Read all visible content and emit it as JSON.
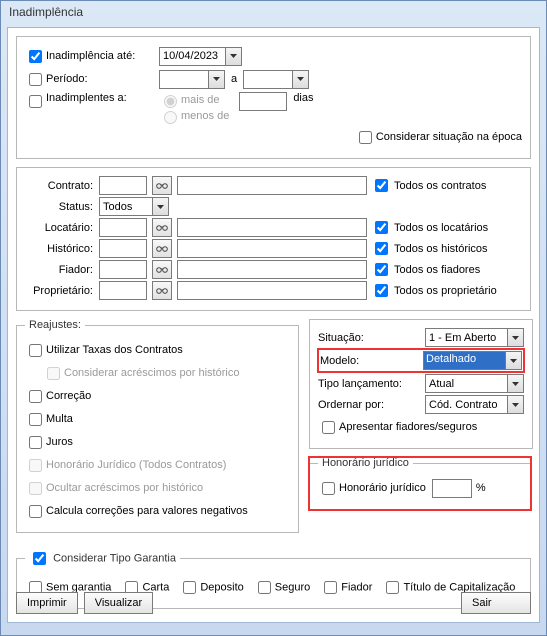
{
  "window": {
    "title": "Inadimplência"
  },
  "top": {
    "inadimp_ate_label": "Inadimplência até:",
    "inadimp_ate_checked": true,
    "inadimp_ate_value": "10/04/2023",
    "periodo_label": "Período:",
    "periodo_checked": false,
    "periodo_sep": "a",
    "inadimplentes_label": "Inadimplentes a:",
    "inadimplentes_checked": false,
    "radio_mais": "mais de",
    "radio_menos": "menos de",
    "dias_label": "dias",
    "considerar_epoca": "Considerar situação na época"
  },
  "filters": {
    "contrato_label": "Contrato:",
    "status_label": "Status:",
    "status_value": "Todos",
    "locatario_label": "Locatário:",
    "historico_label": "Histórico:",
    "fiador_label": "Fiador:",
    "proprietario_label": "Proprietário:",
    "todos_contratos": "Todos os contratos",
    "todos_locatarios": "Todos os locatários",
    "todos_historicos": "Todos os históricos",
    "todos_fiadores": "Todos os fiadores",
    "todos_proprietario": "Todos os proprietário"
  },
  "reajustes": {
    "legend": "Reajustes:",
    "taxas": "Utilizar Taxas dos Contratos",
    "acrescimos_hist": "Considerar acréscimos por histórico",
    "correcao": "Correção",
    "multa": "Multa",
    "juros": "Juros",
    "honorario_todos": "Honorário Jurídico (Todos Contratos)",
    "ocultar_acrescimos": "Ocultar acréscimos por histórico",
    "calcula_neg": "Calcula correções para valores negativos"
  },
  "right": {
    "situacao_label": "Situação:",
    "situacao_value": "1 - Em Aberto",
    "modelo_label": "Modelo:",
    "modelo_value": "Detalhado",
    "tipo_lanc_label": "Tipo lançamento:",
    "tipo_lanc_value": "Atual",
    "ordenar_label": "Ordernar por:",
    "ordenar_value": "Cód. Contrato",
    "apresentar_fiadores": "Apresentar fiadores/seguros"
  },
  "honorario": {
    "legend": "Honorário jurídico",
    "label": "Honorário jurídico",
    "percent": "%"
  },
  "garantia": {
    "considerar": "Considerar Tipo Garantia",
    "sem": "Sem garantia",
    "carta": "Carta",
    "deposito": "Deposito",
    "seguro": "Seguro",
    "fiador": "Fiador",
    "titulo": "Título de Capitalização"
  },
  "buttons": {
    "imprimir": "Imprimir",
    "visualizar": "Visualizar",
    "sair": "Sair"
  }
}
